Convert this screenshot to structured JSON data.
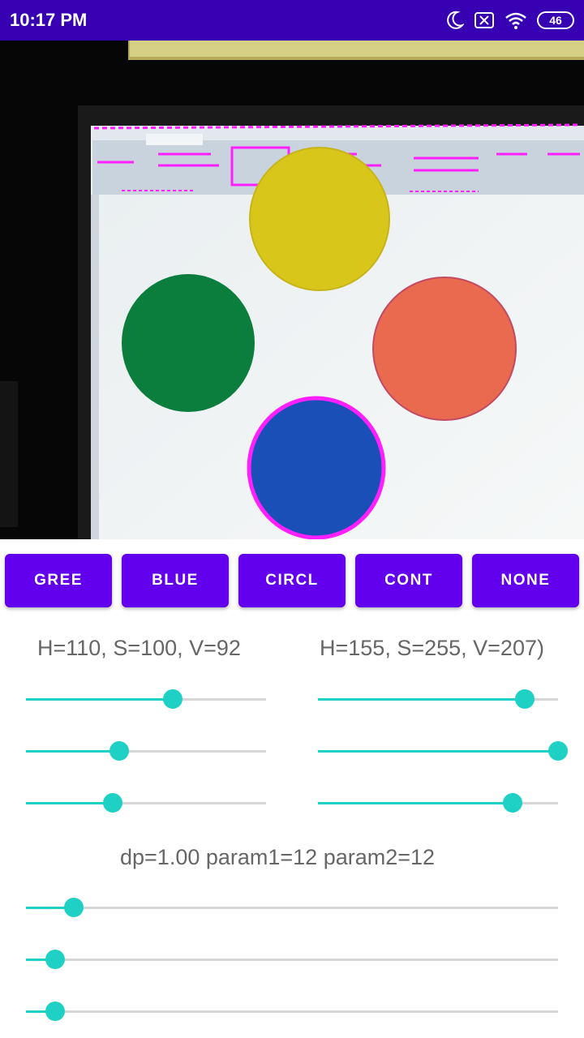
{
  "status_bar": {
    "time": "10:17 PM",
    "battery": "46",
    "icons": [
      "moon-icon",
      "notification-x-icon",
      "wifi-icon",
      "battery-icon"
    ]
  },
  "camera_preview": {
    "content": "camera-feed",
    "detected_colors": [
      "#d8c61a",
      "#0a7a3a",
      "#e96a4f",
      "#1b4fb8"
    ],
    "highlight_color": "#ff1fff"
  },
  "buttons": [
    {
      "label": "GREE"
    },
    {
      "label": "BLUE"
    },
    {
      "label": "CIRCL"
    },
    {
      "label": "CONT"
    },
    {
      "label": "NONE"
    }
  ],
  "hsv": {
    "lower_text": "H=110, S=100, V=92",
    "upper_text": "H=155, S=255, V=207)"
  },
  "hsv_sliders": {
    "lower": [
      0.61,
      0.39,
      0.36
    ],
    "upper": [
      0.86,
      1.0,
      0.81
    ]
  },
  "hough": {
    "text": "dp=1.00 param1=12 param2=12"
  },
  "hough_sliders": [
    0.09,
    0.055,
    0.055
  ],
  "colors": {
    "status_bar": "#3700b3",
    "button": "#6200ee",
    "slider_accent": "#1fd1c5",
    "slider_track": "#d6d6d6",
    "readout_text": "#666666"
  }
}
